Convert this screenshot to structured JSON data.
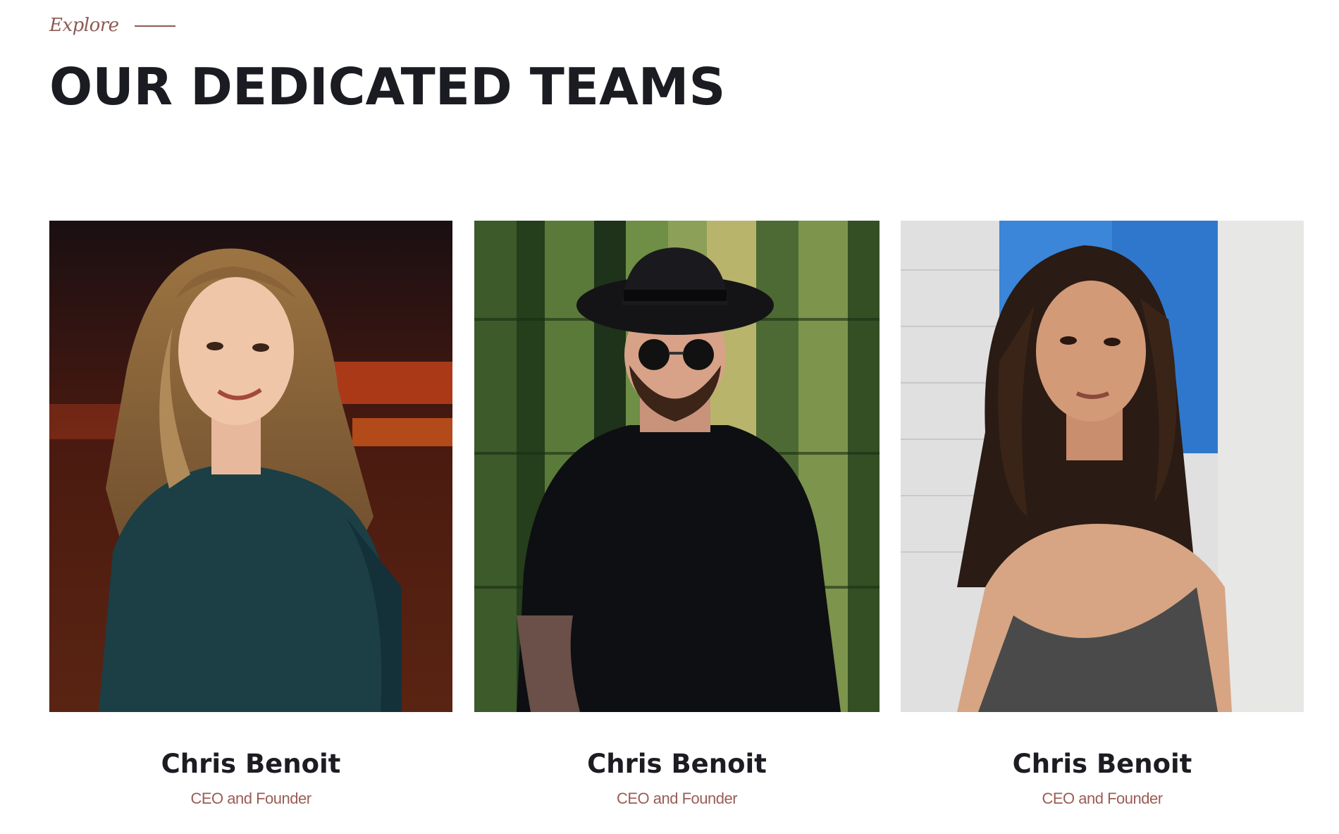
{
  "section": {
    "eyebrow": "Explore",
    "title": "OUR DEDICATED TEAMS"
  },
  "team": [
    {
      "name": "Chris Benoit",
      "role": "CEO and Founder",
      "photo": "woman-smiling-portrait"
    },
    {
      "name": "Chris Benoit",
      "role": "CEO and Founder",
      "photo": "man-hat-sunglasses-portrait"
    },
    {
      "name": "Chris Benoit",
      "role": "CEO and Founder",
      "photo": "woman-gray-top-portrait"
    }
  ],
  "colors": {
    "accent": "#8e5a52",
    "heading": "#1b1c22"
  }
}
